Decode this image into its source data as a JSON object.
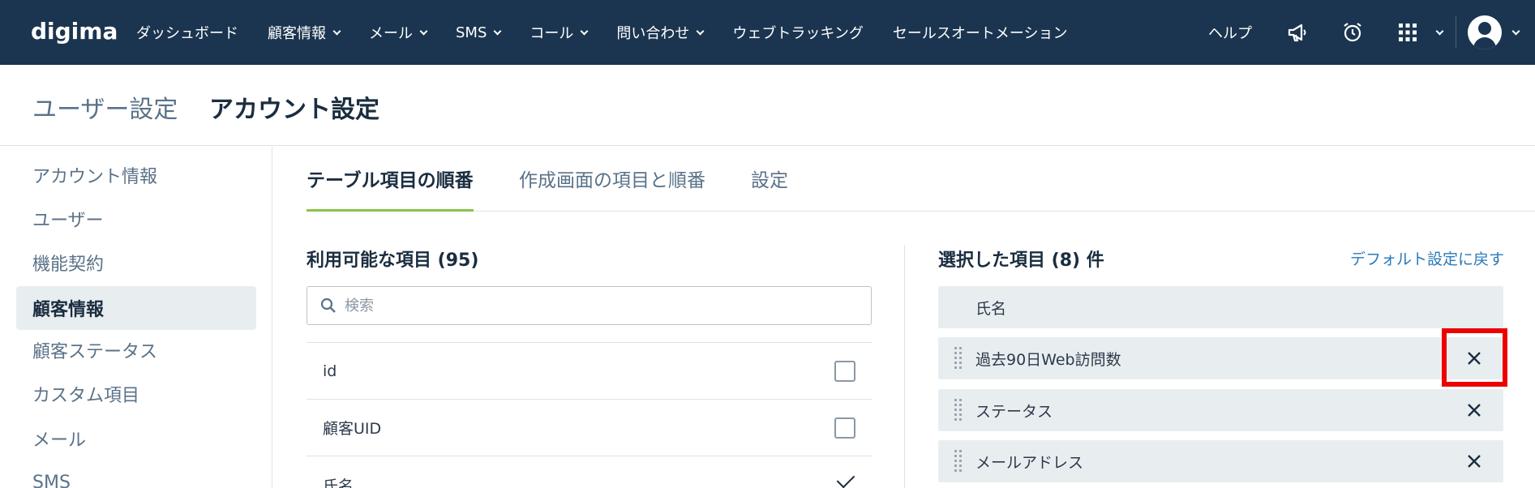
{
  "nav": {
    "logo": "digima",
    "items": [
      {
        "label": "ダッシュボード",
        "chevron": false
      },
      {
        "label": "顧客情報",
        "chevron": true
      },
      {
        "label": "メール",
        "chevron": true
      },
      {
        "label": "SMS",
        "chevron": true
      },
      {
        "label": "コール",
        "chevron": true
      },
      {
        "label": "問い合わせ",
        "chevron": true
      },
      {
        "label": "ウェブトラッキング",
        "chevron": false
      },
      {
        "label": "セールスオートメーション",
        "chevron": false
      }
    ],
    "help": "ヘルプ",
    "icons": [
      "megaphone-icon",
      "alarm-clock-icon",
      "apps-grid-icon",
      "user-avatar-icon"
    ]
  },
  "header": {
    "parent": "ユーザー設定",
    "current": "アカウント設定"
  },
  "sidebar": {
    "items": [
      {
        "label": "アカウント情報",
        "active": false
      },
      {
        "label": "ユーザー",
        "active": false
      },
      {
        "label": "機能契約",
        "active": false
      },
      {
        "label": "顧客情報",
        "active": true
      },
      {
        "label": "顧客ステータス",
        "active": false
      },
      {
        "label": "カスタム項目",
        "active": false
      },
      {
        "label": "メール",
        "active": false
      },
      {
        "label": "SMS",
        "active": false
      }
    ]
  },
  "tabs": [
    {
      "label": "テーブル項目の順番",
      "active": true
    },
    {
      "label": "作成画面の項目と順番",
      "active": false
    },
    {
      "label": "設定",
      "active": false
    }
  ],
  "available": {
    "title": "利用可能な項目 (95)",
    "search_placeholder": "検索",
    "rows": [
      {
        "label": "id",
        "checked": false
      },
      {
        "label": "顧客UID",
        "checked": false
      },
      {
        "label": "氏名",
        "checked": true
      }
    ]
  },
  "selected": {
    "title": "選択した項目 (8) 件",
    "reset_label": "デフォルト設定に戻す",
    "rows": [
      {
        "label": "氏名",
        "removable": false
      },
      {
        "label": "過去90日Web訪問数",
        "removable": true
      },
      {
        "label": "ステータス",
        "removable": true
      },
      {
        "label": "メールアドレス",
        "removable": true
      }
    ]
  },
  "colors": {
    "nav_bg": "#1b3550",
    "accent_green": "#8bc34a",
    "link_blue": "#2a7ab8",
    "highlight_red": "#ee0000"
  }
}
